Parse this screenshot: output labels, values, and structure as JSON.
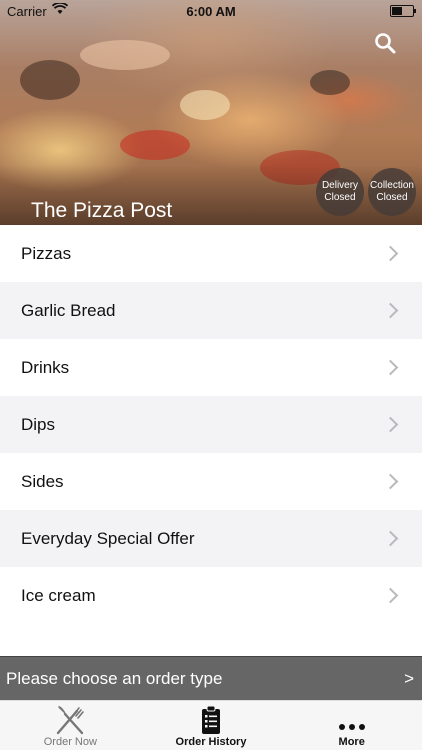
{
  "status_bar": {
    "carrier": "Carrier",
    "time": "6:00 AM"
  },
  "header": {
    "store_name": "The Pizza Post",
    "delivery": {
      "line1": "Delivery",
      "line2": "Closed"
    },
    "collection": {
      "line1": "Collection",
      "line2": "Closed"
    },
    "search_icon": "search-icon"
  },
  "menu": {
    "items": [
      {
        "label": "Pizzas"
      },
      {
        "label": "Garlic Bread"
      },
      {
        "label": "Drinks"
      },
      {
        "label": "Dips"
      },
      {
        "label": "Sides"
      },
      {
        "label": "Everyday Special Offer"
      },
      {
        "label": "Ice cream"
      }
    ]
  },
  "order_bar": {
    "label": "Please choose an order type",
    "arrow": ">"
  },
  "tabs": [
    {
      "label": "Order Now",
      "icon": "fork-knife-icon"
    },
    {
      "label": "Order History",
      "icon": "clipboard-icon"
    },
    {
      "label": "More",
      "icon": "more-dots-icon"
    }
  ]
}
